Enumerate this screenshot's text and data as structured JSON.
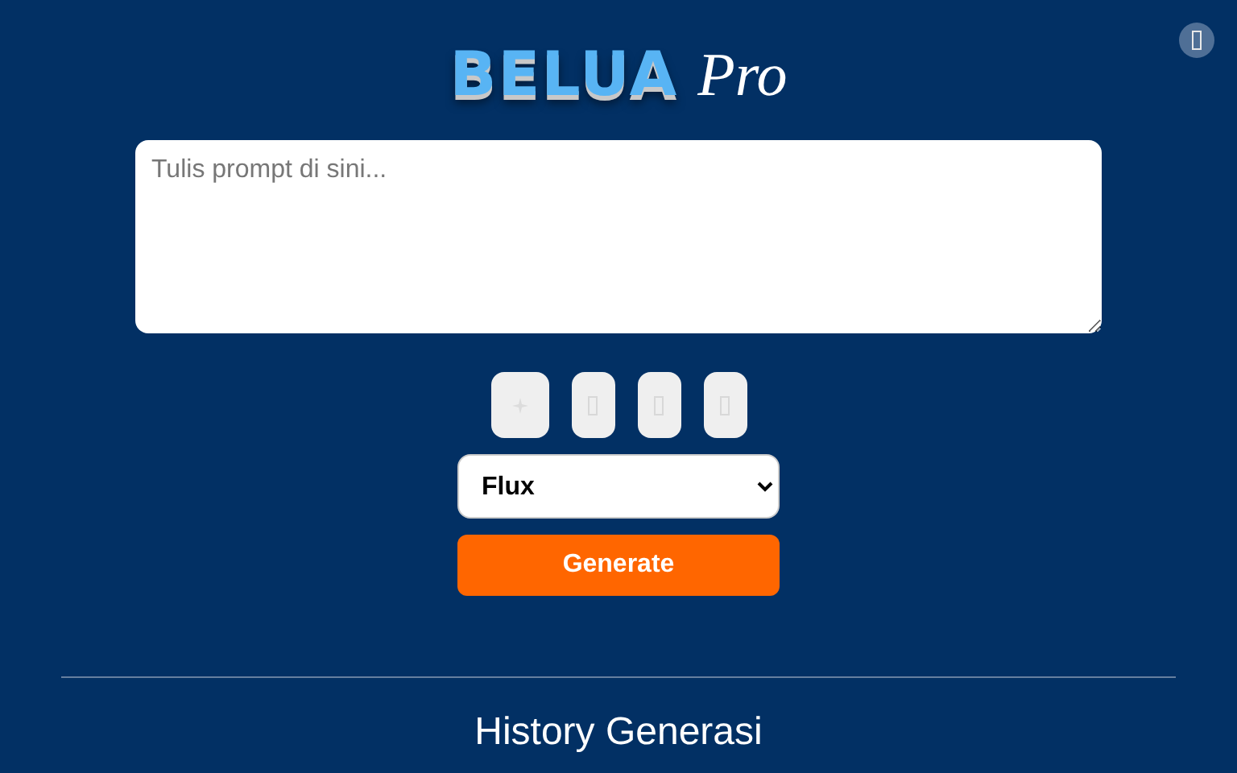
{
  "logo": {
    "brand": "BELUA",
    "suffix": "Pro"
  },
  "prompt": {
    "placeholder": "Tulis prompt di sini..."
  },
  "tools": [
    {
      "kind": "sparkle"
    },
    {
      "kind": "glyph"
    },
    {
      "kind": "glyph"
    },
    {
      "kind": "glyph"
    }
  ],
  "model_select": {
    "value": "Flux"
  },
  "generate_button": {
    "label": "Generate"
  },
  "history": {
    "title": "History Generasi"
  }
}
